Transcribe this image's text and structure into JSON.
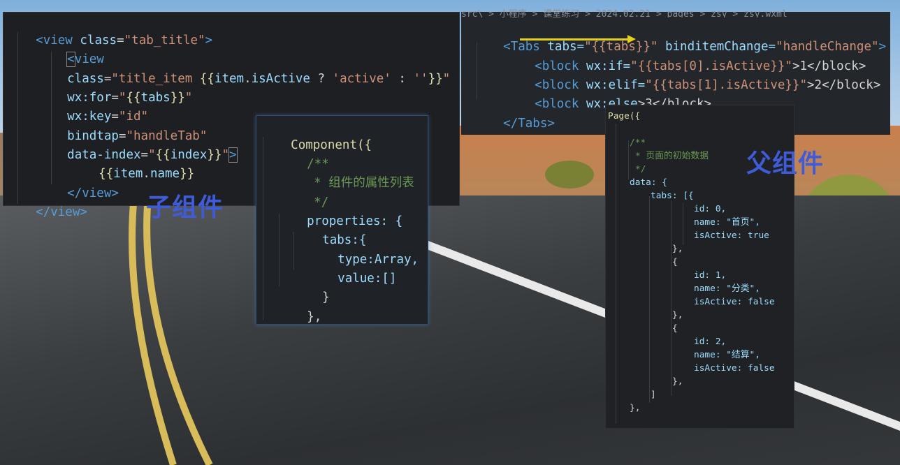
{
  "labels": {
    "child": "子组件",
    "parent": "父组件"
  },
  "colors": {
    "label_blue": "#3f5bd8",
    "arrow_yellow": "#e6d11a"
  },
  "top_panel": {
    "breadcrumb": "src\\ > 小程序 > 课堂练习 > 2024.02.21 > pages > zsy > zsy.wxml",
    "lines": [
      {
        "open": "<Tabs",
        "a1": "tabs=",
        "v1": "\"{{tabs}}\"",
        "a2": "binditemChange=",
        "v2": "\"handleChange\"",
        "close": ">"
      },
      {
        "open": "<block",
        "a1": "wx:if=",
        "v1": "\"{{tabs[0].isActive}}\"",
        "txt": ">1</block>"
      },
      {
        "open": "<block",
        "a1": "wx:elif=",
        "v1": "\"{{tabs[1].isActive}}\"",
        "txt": ">2</block>"
      },
      {
        "open": "<block",
        "a1": "wx:else",
        "txt": ">3</block>"
      },
      {
        "open": "</Tabs>"
      }
    ]
  },
  "left_panel": {
    "lines": [
      "<view class=\"tab_title\">",
      "<view",
      "class=\"title_item {{item.isActive ? 'active' : ''}}\"",
      "wx:for=\"{{tabs}}\"",
      "wx:key=\"id\"",
      "bindtap=\"handleTab\"",
      "data-index=\"{{index}}\">",
      "{{item.name}}",
      "</view>",
      "</view>"
    ]
  },
  "component_panel": {
    "lines": [
      "Component({",
      "/**",
      "* 组件的属性列表",
      "*/",
      "properties: {",
      "tabs:{",
      "type:Array,",
      "value:[]",
      "}",
      "},"
    ]
  },
  "page_panel": {
    "lines": [
      "Page({",
      "/**",
      "* 页面的初始数据",
      "*/",
      "data: {",
      "tabs: [{",
      "id: 0,",
      "name: \"首页\",",
      "isActive: true",
      "},",
      "{",
      "id: 1,",
      "name: \"分类\",",
      "isActive: false",
      "},",
      "{",
      "id: 2,",
      "name: \"结算\",",
      "isActive: false",
      "},",
      "]",
      "},"
    ]
  }
}
